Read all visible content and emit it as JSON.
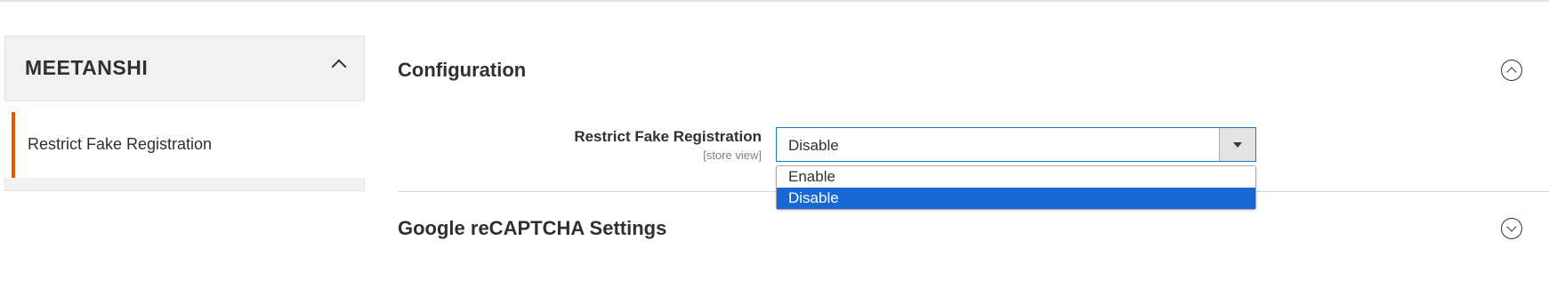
{
  "sidebar": {
    "brand": "MEETANSHI",
    "items": [
      {
        "label": "Restrict Fake Registration"
      }
    ]
  },
  "main": {
    "sections": [
      {
        "title": "Configuration"
      },
      {
        "title": "Google reCAPTCHA Settings"
      }
    ],
    "field": {
      "label": "Restrict Fake Registration",
      "scope": "[store view]",
      "value": "Disable",
      "options": [
        "Enable",
        "Disable"
      ]
    }
  },
  "colors": {
    "accent": "#eb5202",
    "select_border": "#1979c3",
    "highlight": "#1967d2"
  }
}
